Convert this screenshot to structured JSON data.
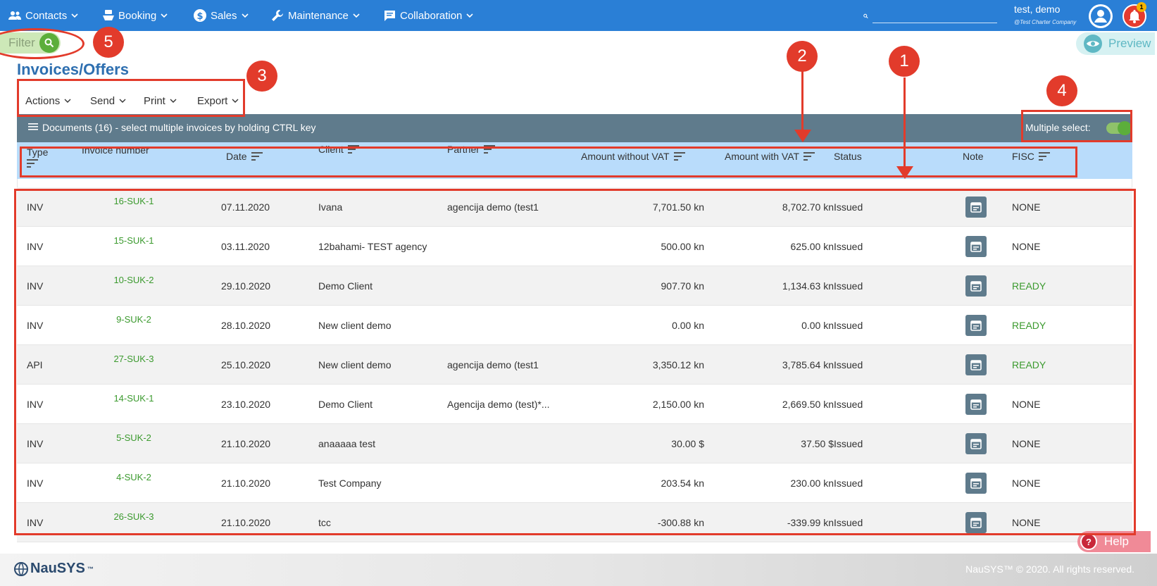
{
  "nav": {
    "items": [
      {
        "label": "Contacts",
        "icon": "people-icon"
      },
      {
        "label": "Booking",
        "icon": "boat-icon"
      },
      {
        "label": "Sales",
        "icon": "dollar-icon"
      },
      {
        "label": "Maintenance",
        "icon": "wrench-icon"
      },
      {
        "label": "Collaboration",
        "icon": "chat-icon"
      }
    ],
    "search_value": "",
    "user_name": "test, demo",
    "user_company": "@Test Charter Company",
    "notification_count": "1"
  },
  "page": {
    "filter_label": "Filter",
    "preview_label": "Preview",
    "title": "Invoices/Offers"
  },
  "toolbar": {
    "actions": "Actions",
    "send": "Send",
    "print": "Print",
    "export": "Export"
  },
  "docs_bar": {
    "text": "Documents (16) - select multiple invoices by holding CTRL key",
    "multiple_select_label": "Multiple select:",
    "multiple_select_on": true
  },
  "table": {
    "headers": {
      "type": "Type",
      "invoice_number": "Invoice number",
      "date": "Date",
      "client": "Client",
      "partner": "Partner",
      "amount_without_vat": "Amount without VAT",
      "amount_with_vat": "Amount with VAT",
      "status": "Status",
      "note": "Note",
      "fisc": "FISC"
    },
    "rows": [
      {
        "type": "INV",
        "number": "16-SUK-1",
        "date": "07.11.2020",
        "client": "Ivana",
        "partner": "agencija demo (test1",
        "without_vat": "7,701.50 kn",
        "with_vat": "8,702.70 kn",
        "status": "Issued",
        "fisc": "NONE"
      },
      {
        "type": "INV",
        "number": "15-SUK-1",
        "date": "03.11.2020",
        "client": "12bahami- TEST agency",
        "partner": "",
        "without_vat": "500.00 kn",
        "with_vat": "625.00 kn",
        "status": "Issued",
        "fisc": "NONE"
      },
      {
        "type": "INV",
        "number": "10-SUK-2",
        "date": "29.10.2020",
        "client": "Demo Client",
        "partner": "",
        "without_vat": "907.70 kn",
        "with_vat": "1,134.63 kn",
        "status": "Issued",
        "fisc": "READY"
      },
      {
        "type": "INV",
        "number": "9-SUK-2",
        "date": "28.10.2020",
        "client": "New client demo",
        "partner": "",
        "without_vat": "0.00 kn",
        "with_vat": "0.00 kn",
        "status": "Issued",
        "fisc": "READY"
      },
      {
        "type": "API",
        "number": "27-SUK-3",
        "date": "25.10.2020",
        "client": "New client demo",
        "partner": "agencija demo (test1",
        "without_vat": "3,350.12 kn",
        "with_vat": "3,785.64 kn",
        "status": "Issued",
        "fisc": "READY"
      },
      {
        "type": "INV",
        "number": "14-SUK-1",
        "date": "23.10.2020",
        "client": "Demo Client",
        "partner": "Agencija demo (test)*...",
        "without_vat": "2,150.00 kn",
        "with_vat": "2,669.50 kn",
        "status": "Issued",
        "fisc": "NONE"
      },
      {
        "type": "INV",
        "number": "5-SUK-2",
        "date": "21.10.2020",
        "client": "anaaaaa test",
        "partner": "",
        "without_vat": "30.00 $",
        "with_vat": "37.50 $",
        "status": "Issued",
        "fisc": "NONE"
      },
      {
        "type": "INV",
        "number": "4-SUK-2",
        "date": "21.10.2020",
        "client": "Test Company",
        "partner": "",
        "without_vat": "203.54 kn",
        "with_vat": "230.00 kn",
        "status": "Issued",
        "fisc": "NONE"
      },
      {
        "type": "INV",
        "number": "26-SUK-3",
        "date": "21.10.2020",
        "client": "tcc",
        "partner": "",
        "without_vat": "-300.88 kn",
        "with_vat": "-339.99 kn",
        "status": "Issued",
        "fisc": "NONE"
      }
    ]
  },
  "footer": {
    "logo": "NauSYS",
    "logo_tm": "™",
    "copyright": "NauSYS™ © 2020. All rights reserved.",
    "help_label": "Help"
  },
  "annotations": [
    "1",
    "2",
    "3",
    "4",
    "5"
  ],
  "colors": {
    "navbar": "#2a7fd6",
    "header_row": "#b9dcfb",
    "docs_bar": "#5f7b8c",
    "ready": "#3b9a2e",
    "annotation": "#e23b2b"
  }
}
